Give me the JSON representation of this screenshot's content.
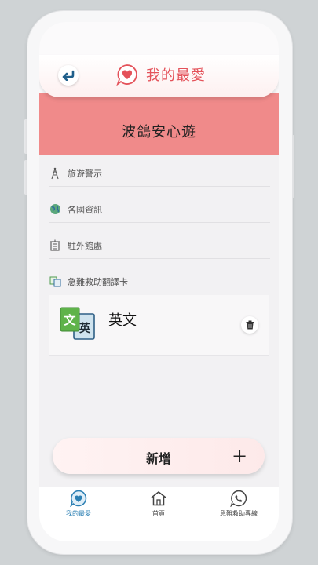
{
  "header": {
    "title": "我的最愛"
  },
  "app_name": "波鴿安心遊",
  "menu": [
    {
      "label": "旅遊警示",
      "icon": "tower-icon"
    },
    {
      "label": "各國資訊",
      "icon": "globe-icon"
    },
    {
      "label": "駐外館處",
      "icon": "building-icon"
    },
    {
      "label": "急難救助翻譯卡",
      "icon": "translate-icon"
    }
  ],
  "favorites": [
    {
      "label": "英文",
      "icon_chars": [
        "文",
        "英"
      ]
    }
  ],
  "add_button": {
    "label": "新增",
    "plus": "+"
  },
  "tabs": [
    {
      "label": "我的最愛",
      "active": true
    },
    {
      "label": "首頁",
      "active": false
    },
    {
      "label": "急難救助專線",
      "active": false
    }
  ],
  "colors": {
    "accent_pink": "#f08a8a",
    "title_red": "#e4525a",
    "tab_active": "#2b7fb3"
  }
}
